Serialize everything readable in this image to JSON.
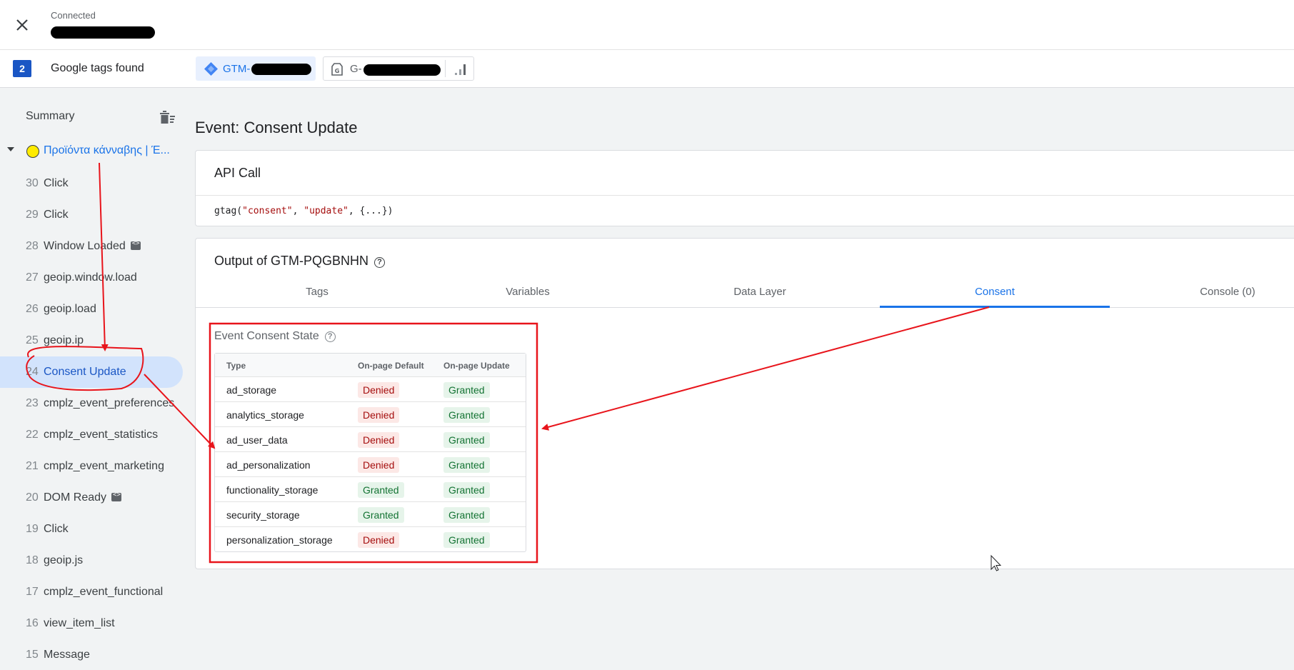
{
  "header": {
    "status": "Connected"
  },
  "tags_bar": {
    "count": "2",
    "label": "Google tags found",
    "gtm_chip": "GTM-",
    "ga_chip": "G-"
  },
  "sidebar": {
    "title": "Summary",
    "page": "Προϊόντα κάνναβης | Έ...",
    "events": [
      {
        "num": "30",
        "name": "Click"
      },
      {
        "num": "29",
        "name": "Click"
      },
      {
        "num": "28",
        "name": "Window Loaded"
      },
      {
        "num": "27",
        "name": "geoip.window.load"
      },
      {
        "num": "26",
        "name": "geoip.load"
      },
      {
        "num": "25",
        "name": "geoip.ip"
      },
      {
        "num": "24",
        "name": "Consent Update"
      },
      {
        "num": "23",
        "name": "cmplz_event_preferences"
      },
      {
        "num": "22",
        "name": "cmplz_event_statistics"
      },
      {
        "num": "21",
        "name": "cmplz_event_marketing"
      },
      {
        "num": "20",
        "name": "DOM Ready"
      },
      {
        "num": "19",
        "name": "Click"
      },
      {
        "num": "18",
        "name": "geoip.js"
      },
      {
        "num": "17",
        "name": "cmplz_event_functional"
      },
      {
        "num": "16",
        "name": "view_item_list"
      },
      {
        "num": "15",
        "name": "Message"
      }
    ]
  },
  "main": {
    "title": "Event: Consent Update",
    "api_card": {
      "title": "API Call",
      "code_fn": "gtag(",
      "code_arg1": "\"consent\"",
      "code_sep": ", ",
      "code_arg2": "\"update\"",
      "code_rest": ", {...})"
    },
    "output_card": {
      "title": "Output of GTM-PQGBNHN",
      "tabs": [
        "Tags",
        "Variables",
        "Data Layer",
        "Consent",
        "Console (0)"
      ],
      "active_tab": "Consent",
      "consent_title": "Event Consent State",
      "columns": [
        "Type",
        "On-page Default",
        "On-page Update"
      ],
      "rows": [
        {
          "type": "ad_storage",
          "default": "Denied",
          "update": "Granted"
        },
        {
          "type": "analytics_storage",
          "default": "Denied",
          "update": "Granted"
        },
        {
          "type": "ad_user_data",
          "default": "Denied",
          "update": "Granted"
        },
        {
          "type": "ad_personalization",
          "default": "Denied",
          "update": "Granted"
        },
        {
          "type": "functionality_storage",
          "default": "Granted",
          "update": "Granted"
        },
        {
          "type": "security_storage",
          "default": "Granted",
          "update": "Granted"
        },
        {
          "type": "personalization_storage",
          "default": "Denied",
          "update": "Granted"
        }
      ]
    }
  },
  "colors": {
    "accent": "#1a73e8",
    "annotation": "#e8141b",
    "denied_bg": "#fce8e6",
    "granted_bg": "#e6f4ea"
  }
}
